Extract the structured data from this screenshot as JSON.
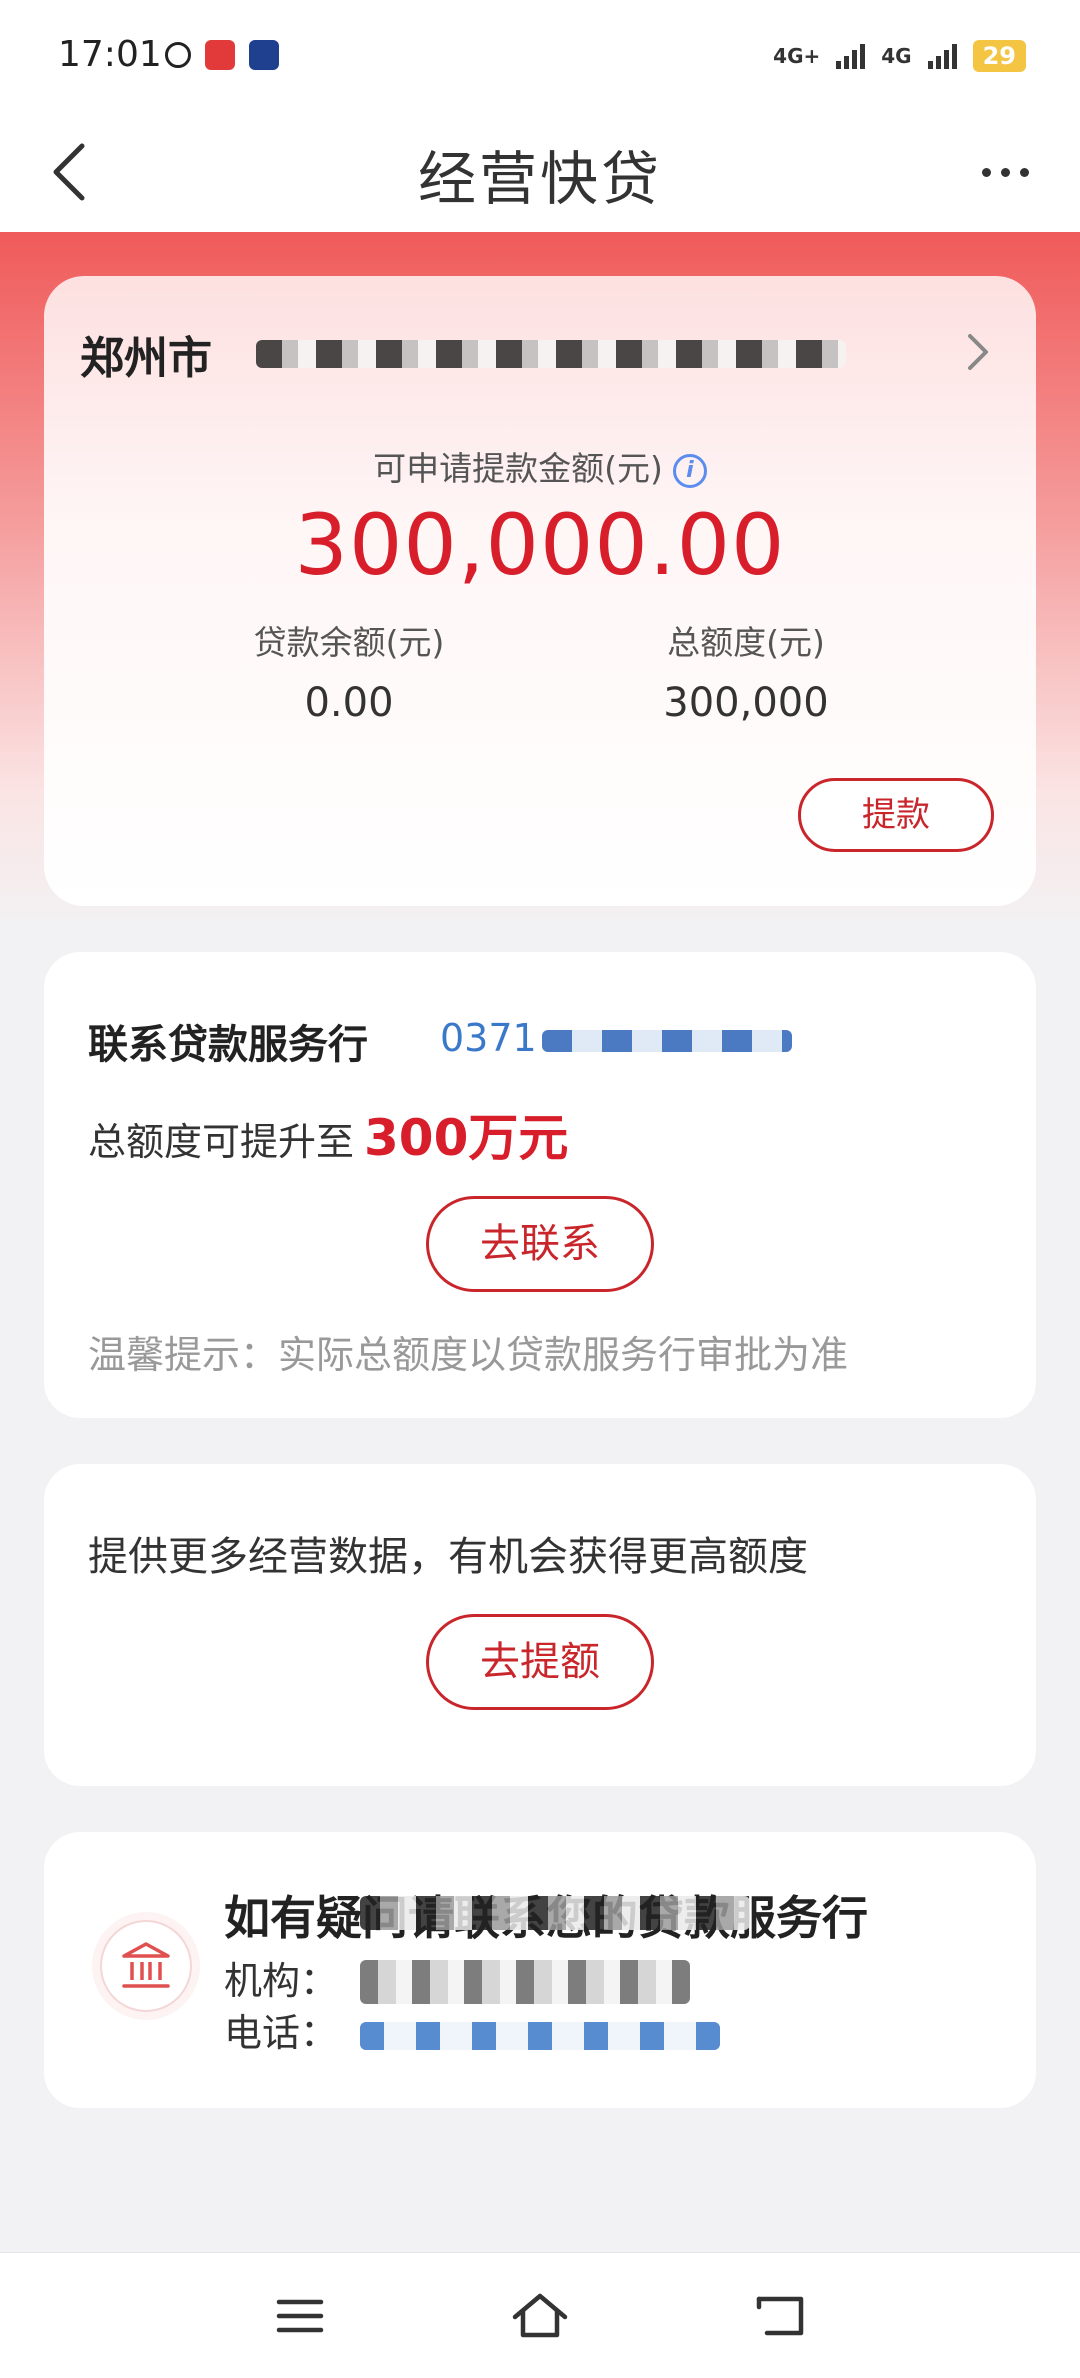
{
  "status_bar": {
    "time": "17:01",
    "network_1": "4G+",
    "network_2": "4G",
    "battery": "29"
  },
  "header": {
    "title": "经营快贷"
  },
  "loan_card": {
    "company_city": "郑州市",
    "available_label": "可申请提款金额(元)",
    "available_amount": "300,000.00",
    "balance_label": "贷款余额(元)",
    "balance_value": "0.00",
    "total_label": "总额度(元)",
    "total_value": "300,000",
    "withdraw_button": "提款"
  },
  "contact_card": {
    "title": "联系贷款服务行",
    "phone_prefix": "0371",
    "quota_text": "总额度可提升至",
    "quota_highlight": "300万元",
    "contact_button": "去联系",
    "tip": "温馨提示：实际总额度以贷款服务行审批为准"
  },
  "data_card": {
    "text": "提供更多经营数据，有机会获得更高额度",
    "button": "去提额"
  },
  "help_card": {
    "title": "如有疑问请联系您的贷款服务行",
    "org_label": "机构：",
    "tel_label": "电话："
  },
  "colors": {
    "accent_red": "#d81e2a",
    "link_blue": "#3a78c9"
  },
  "icons": [
    "back-chevron-icon",
    "more-dots-icon",
    "chevron-right-icon",
    "info-icon",
    "bank-icon",
    "menu-icon",
    "home-icon",
    "back-nav-icon"
  ]
}
